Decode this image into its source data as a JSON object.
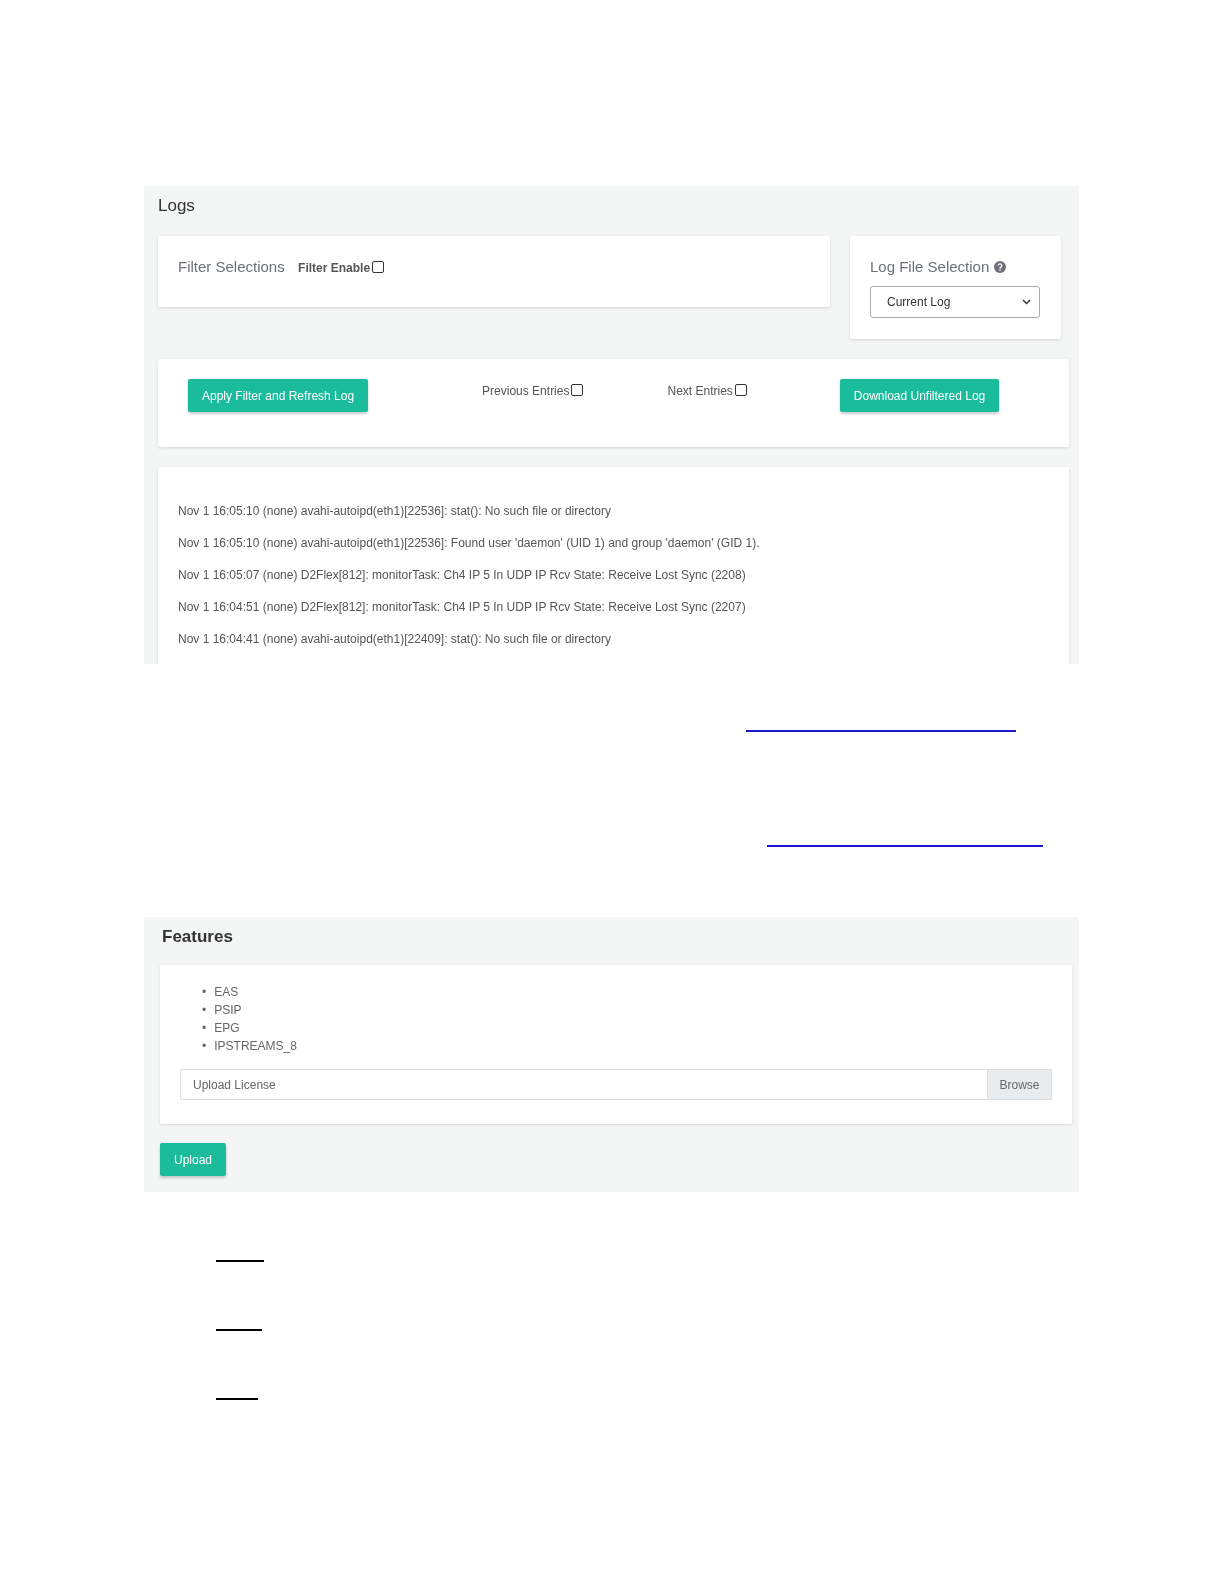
{
  "logs": {
    "title": "Logs",
    "filter": {
      "heading": "Filter Selections",
      "enable_label": "Filter Enable",
      "checked": false
    },
    "log_file": {
      "heading": "Log File Selection",
      "value": "Current Log"
    },
    "actions": {
      "apply_button": "Apply Filter and Refresh Log",
      "previous": {
        "label": "Previous Entries",
        "checked": false
      },
      "next": {
        "label": "Next Entries",
        "checked": false
      },
      "download_button": "Download Unfiltered Log"
    },
    "entries": [
      "Nov 1 16:05:10 (none) avahi-autoipd(eth1)[22536]: stat(): No such file or directory",
      "Nov 1 16:05:10 (none) avahi-autoipd(eth1)[22536]: Found user 'daemon' (UID 1) and group 'daemon' (GID 1).",
      "Nov 1 16:05:07 (none) D2Flex[812]: monitorTask: Ch4 IP 5 In UDP IP Rcv State: Receive Lost Sync (2208)",
      "Nov 1 16:04:51 (none) D2Flex[812]: monitorTask: Ch4 IP 5 In UDP IP Rcv State: Receive Lost Sync (2207)",
      "Nov 1 16:04:41 (none) avahi-autoipd(eth1)[22409]: stat(): No such file or directory"
    ]
  },
  "features": {
    "title": "Features",
    "items": [
      {
        "marker": "•",
        "label": "EAS"
      },
      {
        "marker": "•",
        "label": "PSIP"
      },
      {
        "marker": "•",
        "label": "EPG"
      },
      {
        "marker": "•",
        "label": "IPSTREAMS_8"
      }
    ],
    "license_field": {
      "placeholder": "Upload License",
      "browse_button": "Browse"
    },
    "upload_button": "Upload"
  }
}
